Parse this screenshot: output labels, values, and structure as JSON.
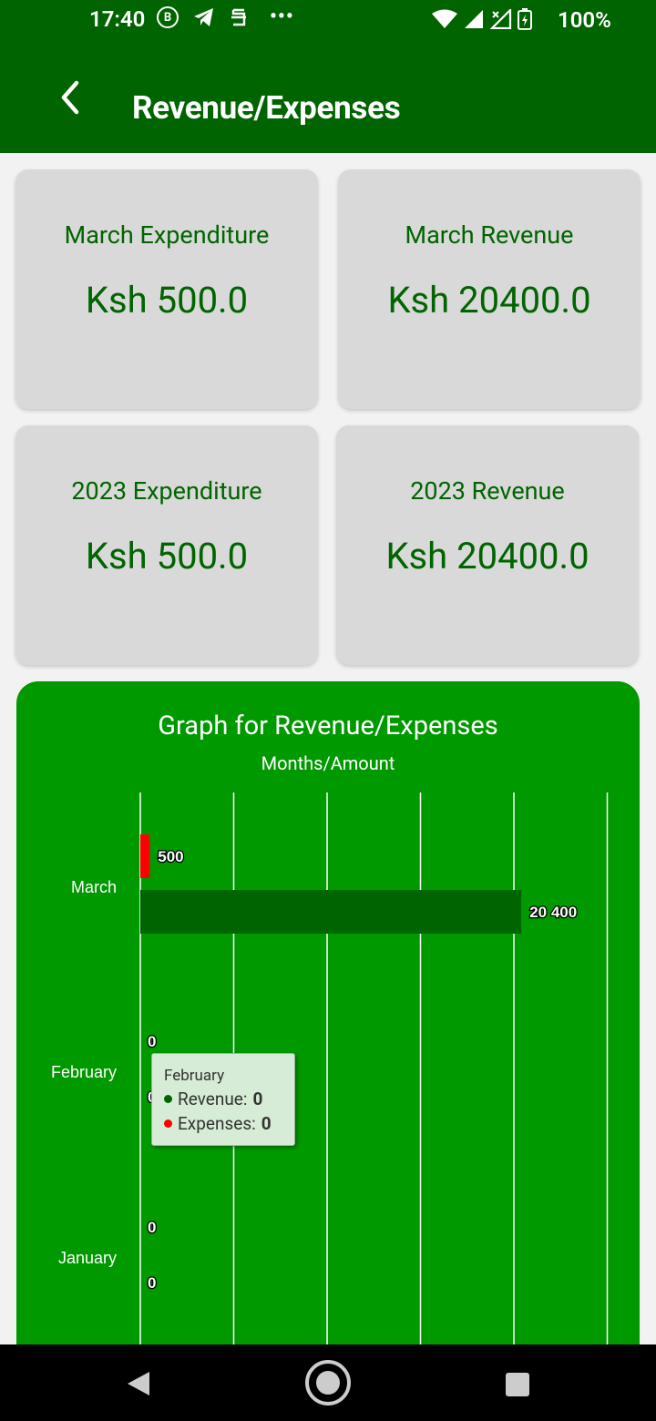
{
  "status_bar": {
    "time": "17:40",
    "b_badge": "B",
    "more": "•••",
    "battery": "100%",
    "icons": [
      "b-badge-icon",
      "telegram-icon",
      "app-icon",
      "more-icon",
      "wifi-icon",
      "signal-icon",
      "signal-x-icon",
      "battery-charging-icon"
    ]
  },
  "app_bar": {
    "title": "Revenue/Expenses",
    "back_icon": "back-arrow-icon"
  },
  "cards": [
    {
      "label": "March Expenditure",
      "value": "Ksh 500.0"
    },
    {
      "label": "March Revenue",
      "value": "Ksh 20400.0"
    },
    {
      "label": "2023 Expenditure",
      "value": "Ksh 500.0"
    },
    {
      "label": "2023 Revenue",
      "value": "Ksh 20400.0"
    }
  ],
  "colors": {
    "primary": "#006400",
    "chart_bg": "#009900",
    "revenue": "#006400",
    "expenses": "#ff0000",
    "card_bg": "#d9d9d9"
  },
  "chart_data": {
    "type": "bar",
    "orientation": "horizontal",
    "title": "Graph for Revenue/Expenses",
    "subtitle": "Months/Amount",
    "categories": [
      "March",
      "February",
      "January"
    ],
    "series": [
      {
        "name": "Expenses",
        "color": "#ff0000",
        "values": [
          500,
          0,
          0
        ],
        "labels": [
          "500",
          "0",
          "0"
        ]
      },
      {
        "name": "Revenue",
        "color": "#006400",
        "values": [
          20400,
          0,
          0
        ],
        "labels": [
          "20 400",
          "0",
          "0"
        ]
      }
    ],
    "xlim": [
      0,
      25000
    ],
    "grid": true
  },
  "tooltip": {
    "month": "February",
    "revenue_label": "Revenue:",
    "revenue_value": "0",
    "expenses_label": "Expenses:",
    "expenses_value": "0"
  },
  "nav_bar": {
    "icons": [
      "nav-back-icon",
      "nav-home-icon",
      "nav-recents-icon"
    ]
  }
}
